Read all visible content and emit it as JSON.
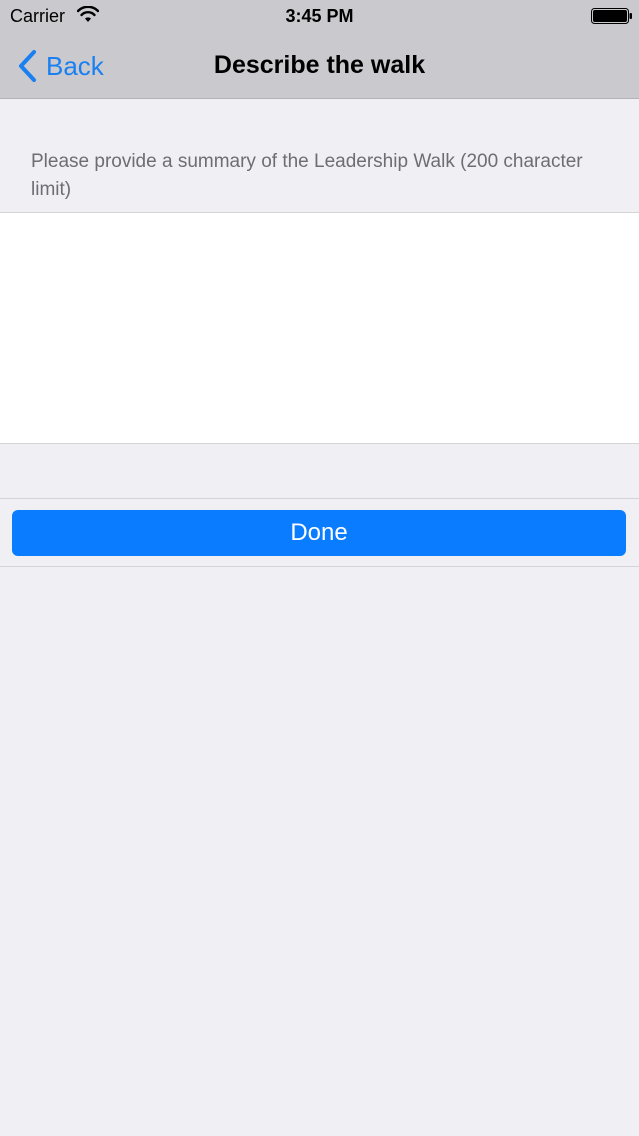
{
  "status_bar": {
    "carrier": "Carrier",
    "time": "3:45 PM",
    "wifi_icon": "wifi-icon",
    "battery_icon": "battery-icon"
  },
  "nav": {
    "back_label": "Back",
    "back_icon": "chevron-left-icon",
    "title": "Describe the walk"
  },
  "form": {
    "prompt": "Please provide a summary of the Leadership Walk (200 character limit)",
    "summary_value": "",
    "done_label": "Done"
  },
  "colors": {
    "accent": "#1a7ff0",
    "button": "#0a7cff",
    "bar_background": "#c9c9ce",
    "page_background": "#efeff4"
  }
}
